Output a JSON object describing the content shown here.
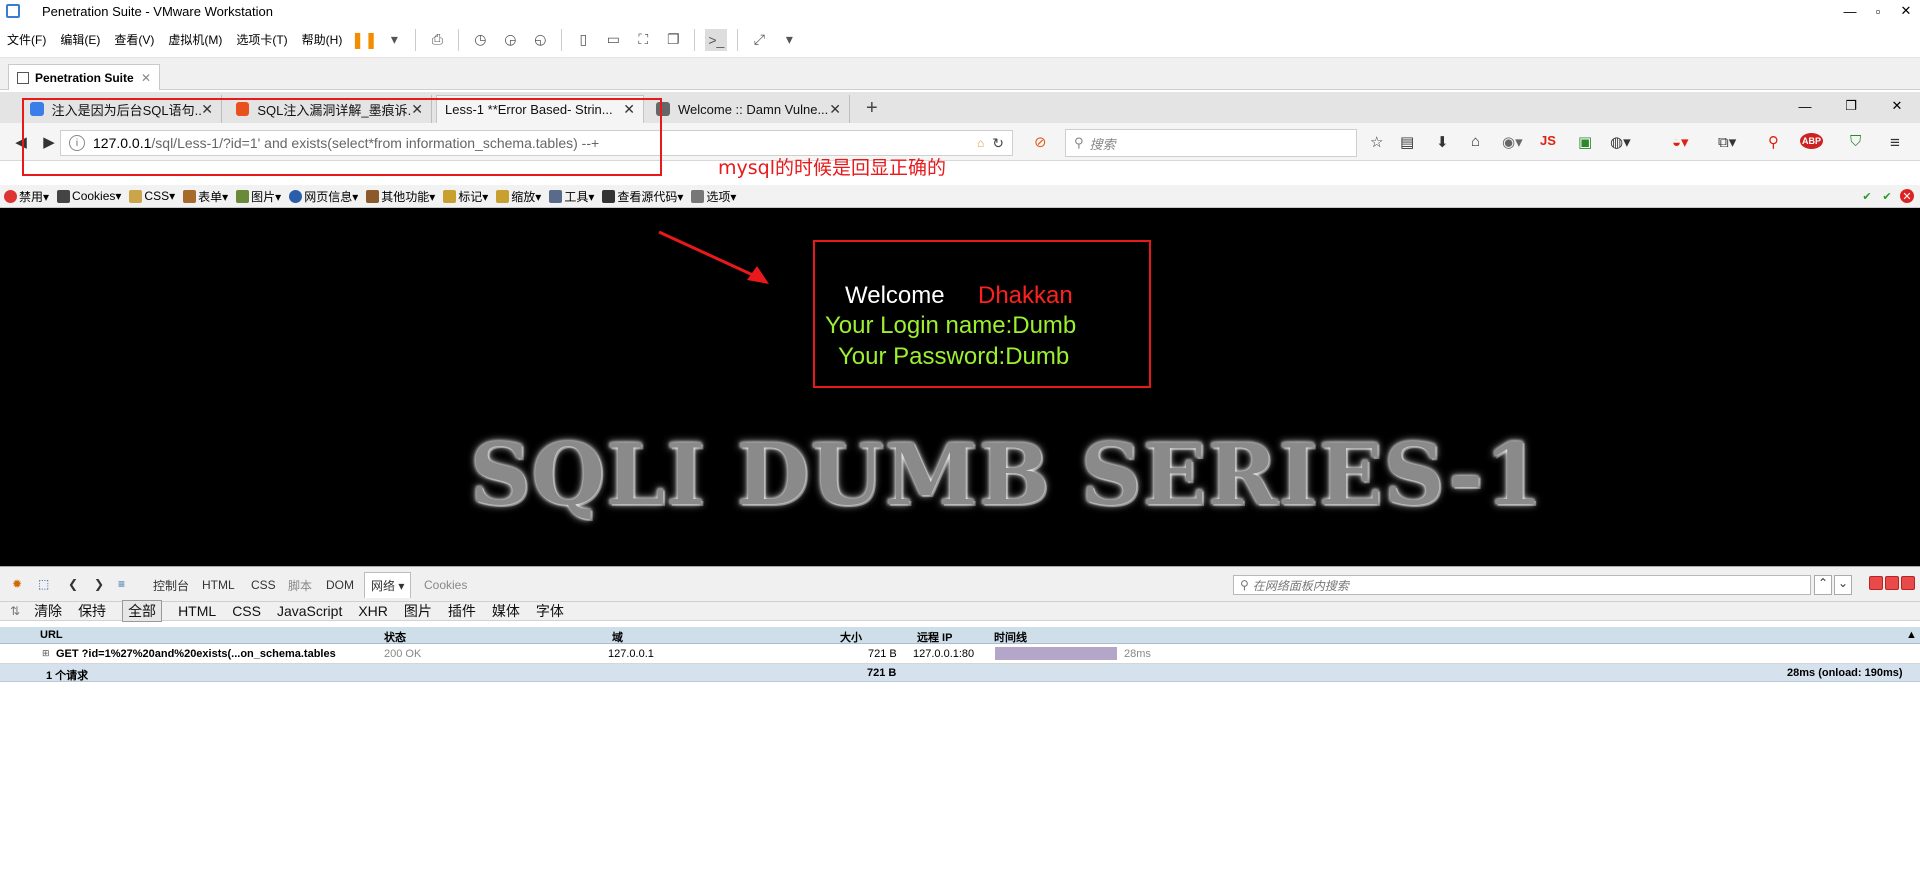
{
  "vmware": {
    "title": "Penetration Suite - VMware Workstation",
    "menu": [
      "文件(F)",
      "编辑(E)",
      "查看(V)",
      "虚拟机(M)",
      "选项卡(T)",
      "帮助(H)"
    ],
    "vm_tab": "Penetration Suite"
  },
  "browser": {
    "tabs": [
      {
        "title": "注入是因为后台SQL语句...",
        "fav_color": "#3b7de9"
      },
      {
        "title": "SQL注入漏洞详解_墨痕诉...",
        "fav_color": "#e8501d"
      },
      {
        "title": "Less-1 **Error Based- Strin...",
        "fav_color": "#ffffff"
      },
      {
        "title": "Welcome :: Damn Vulne...",
        "fav_color": "#666666"
      }
    ],
    "url_host": "127.0.0.1",
    "url_rest": "/sql/Less-1/?id=1' and exists(select*from information_schema.tables) --+",
    "search_placeholder": "搜索",
    "toolbar_js": "JS",
    "toolbar_abp": "ABP"
  },
  "annotation": {
    "text": "mysql的时候是回显正确的"
  },
  "webdev": {
    "items": [
      "禁用▾",
      "Cookies▾",
      "CSS▾",
      "表单▾",
      "图片▾",
      "网页信息▾",
      "其他功能▾",
      "标记▾",
      "缩放▾",
      "工具▾",
      "查看源代码▾",
      "选项▾"
    ]
  },
  "page": {
    "welcome": "Welcome",
    "name": "Dhakkan",
    "login_name": "Your Login name:Dumb",
    "password": "Your Password:Dumb",
    "banner": "SQLI DUMB SERIES-1"
  },
  "firebug": {
    "tabs": [
      "控制台",
      "HTML",
      "CSS",
      "脚本",
      "DOM",
      "网络 ▾",
      "Cookies"
    ],
    "search_placeholder": "在网络面板内搜索",
    "filters": [
      "清除",
      "保持",
      "全部",
      "HTML",
      "CSS",
      "JavaScript",
      "XHR",
      "图片",
      "插件",
      "媒体",
      "字体"
    ],
    "columns": [
      "URL",
      "状态",
      "域",
      "大小",
      "远程 IP",
      "时间线"
    ],
    "row": {
      "url": "GET ?id=1%27%20and%20exists(...on_schema.tables",
      "status": "200 OK",
      "domain": "127.0.0.1",
      "size": "721 B",
      "remote_ip": "127.0.0.1:80",
      "time": "28ms"
    },
    "total": {
      "count": "1 个请求",
      "size": "721 B",
      "time": "28ms (onload: 190ms)"
    }
  }
}
